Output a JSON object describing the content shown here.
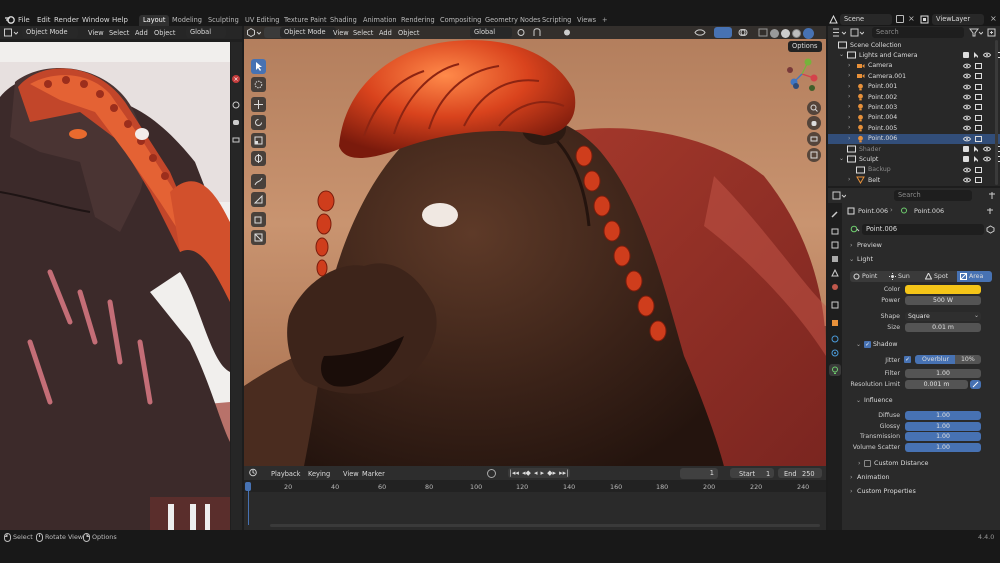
{
  "topbar": {
    "menus": [
      "File",
      "Edit",
      "Render",
      "Window",
      "Help"
    ],
    "workspaces": [
      "Layout",
      "Modeling",
      "Sculpting",
      "UV Editing",
      "Texture Paint",
      "Shading",
      "Animation",
      "Rendering",
      "Compositing",
      "Geometry Nodes",
      "Scripting",
      "Views"
    ],
    "active_workspace": "Layout",
    "scene_label": "Scene",
    "view_layer_label": "ViewLayer"
  },
  "left_editor": {
    "mode": "Object Mode",
    "menus": [
      "View",
      "Select",
      "Add",
      "Object"
    ],
    "orientation": "Global"
  },
  "viewport": {
    "mode": "Object Mode",
    "menus": [
      "View",
      "Select",
      "Add",
      "Object"
    ],
    "orientation": "Global",
    "options_label": "Options"
  },
  "timeline": {
    "menus": [
      "Playback",
      "Keying",
      "View",
      "Marker"
    ],
    "current_frame": "1",
    "start_label": "Start",
    "start_value": "1",
    "end_label": "End",
    "end_value": "250",
    "ticks": [
      "1",
      "20",
      "40",
      "60",
      "80",
      "100",
      "120",
      "140",
      "160",
      "180",
      "200",
      "220",
      "240"
    ]
  },
  "outliner": {
    "search_placeholder": "Search",
    "rows": [
      {
        "label": "Scene Collection",
        "indent": 0,
        "icon": "collection-icon"
      },
      {
        "label": "Lights and Camera",
        "indent": 1,
        "icon": "collection-icon"
      },
      {
        "label": "Camera",
        "indent": 2,
        "icon": "camera-icon"
      },
      {
        "label": "Camera.001",
        "indent": 2,
        "icon": "camera-icon"
      },
      {
        "label": "Point.001",
        "indent": 2,
        "icon": "light-icon"
      },
      {
        "label": "Point.002",
        "indent": 2,
        "icon": "light-icon"
      },
      {
        "label": "Point.003",
        "indent": 2,
        "icon": "light-icon"
      },
      {
        "label": "Point.004",
        "indent": 2,
        "icon": "light-icon"
      },
      {
        "label": "Point.005",
        "indent": 2,
        "icon": "light-icon"
      },
      {
        "label": "Point.006",
        "indent": 2,
        "icon": "light-icon",
        "selected": true
      },
      {
        "label": "Shader",
        "indent": 1,
        "icon": "collection-icon",
        "dim": true
      },
      {
        "label": "Sculpt",
        "indent": 1,
        "icon": "collection-icon"
      },
      {
        "label": "Backup",
        "indent": 2,
        "icon": "collection-icon",
        "dim": true
      },
      {
        "label": "Belt",
        "indent": 2,
        "icon": "mesh-icon"
      }
    ]
  },
  "properties": {
    "search_placeholder": "Search",
    "breadcrumb_object": "Point.006",
    "breadcrumb_data": "Point.006",
    "datablock_name": "Point.006",
    "preview_label": "Preview",
    "light_label": "Light",
    "light_types": [
      "Point",
      "Sun",
      "Spot",
      "Area"
    ],
    "active_light_type": "Area",
    "color_label": "Color",
    "color_value": "#f5c518",
    "power_label": "Power",
    "power_value": "500 W",
    "shape_label": "Shape",
    "shape_value": "Square",
    "size_label": "Size",
    "size_value": "0.01 m",
    "shadow_label": "Shadow",
    "jitter_label": "Jitter",
    "overblur_label": "Overblur",
    "overblur_value": "10%",
    "filter_label": "Filter",
    "filter_value": "1.00",
    "resolution_label": "Resolution Limit",
    "resolution_value": "0.001 m",
    "influence_label": "Influence",
    "influence": [
      {
        "label": "Diffuse",
        "value": "1.00"
      },
      {
        "label": "Glossy",
        "value": "1.00"
      },
      {
        "label": "Transmission",
        "value": "1.00"
      },
      {
        "label": "Volume Scatter",
        "value": "1.00"
      }
    ],
    "custom_distance_label": "Custom Distance",
    "animation_label": "Animation",
    "custom_props_label": "Custom Properties"
  },
  "statusbar": {
    "select_label": "Select",
    "rotate_label": "Rotate View",
    "options_label": "Options",
    "version": "4.4.0"
  },
  "colors": {
    "accent": "#4772b3",
    "selected_row": "#324e7a",
    "light_icon": "#e8913a",
    "camera_icon": "#3fa37f"
  }
}
